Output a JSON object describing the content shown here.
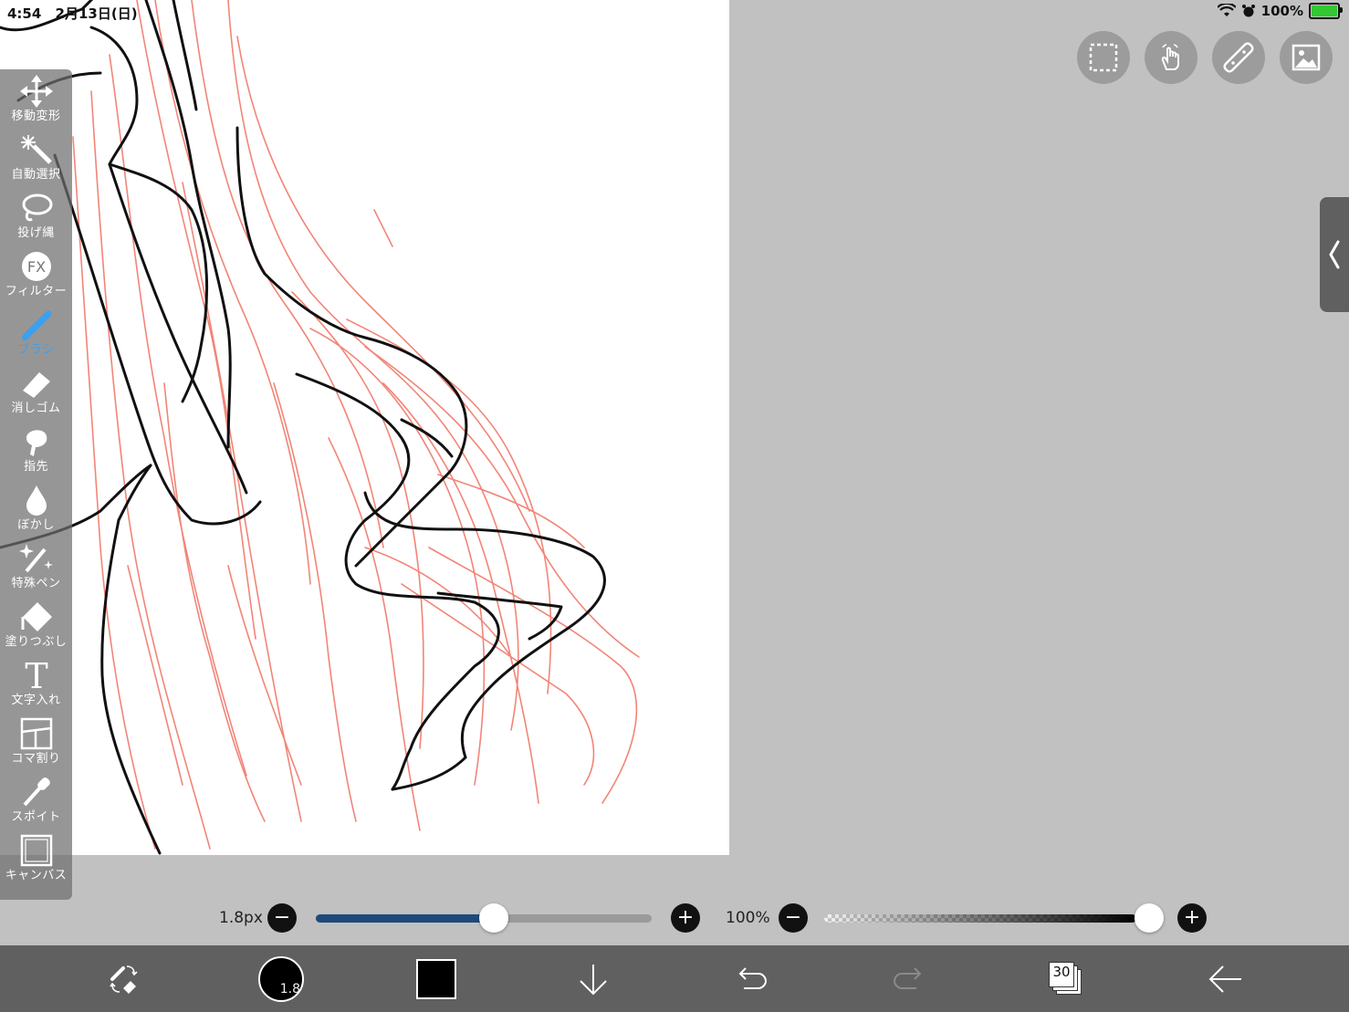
{
  "status_bar": {
    "time": "4:54",
    "date": "2月13日(日)",
    "battery": "100%"
  },
  "tools": [
    {
      "label": "移動変形",
      "icon": "move-icon"
    },
    {
      "label": "自動選択",
      "icon": "magic-wand-icon"
    },
    {
      "label": "投げ縄",
      "icon": "lasso-icon"
    },
    {
      "label": "フィルター",
      "icon": "fx-icon"
    },
    {
      "label": "ブラシ",
      "icon": "brush-icon"
    },
    {
      "label": "消しゴム",
      "icon": "eraser-icon"
    },
    {
      "label": "指先",
      "icon": "smudge-icon"
    },
    {
      "label": "ぼかし",
      "icon": "blur-drop-icon"
    },
    {
      "label": "特殊ペン",
      "icon": "special-pen-icon"
    },
    {
      "label": "塗りつぶし",
      "icon": "fill-bucket-icon"
    },
    {
      "label": "文字入れ",
      "icon": "text-icon"
    },
    {
      "label": "コマ割り",
      "icon": "panel-icon"
    },
    {
      "label": "スポイト",
      "icon": "eyedropper-icon"
    },
    {
      "label": "キャンバス",
      "icon": "canvas-icon"
    }
  ],
  "active_tool": "ブラシ",
  "top_buttons": [
    "selection-icon",
    "gesture-icon",
    "ruler-icon",
    "image-icon"
  ],
  "brush_size": {
    "label": "1.8px",
    "level": 0.53
  },
  "opacity": {
    "label": "100%",
    "level": 1.0
  },
  "bottom_bar": {
    "brush_size_short": "1.8",
    "layer_count": "30",
    "colors": {
      "current": "#000000"
    }
  },
  "colors": {
    "accent": "#3aa0f0",
    "slider_fill": "#1e4a7a",
    "sketch_red": "#f07060"
  }
}
